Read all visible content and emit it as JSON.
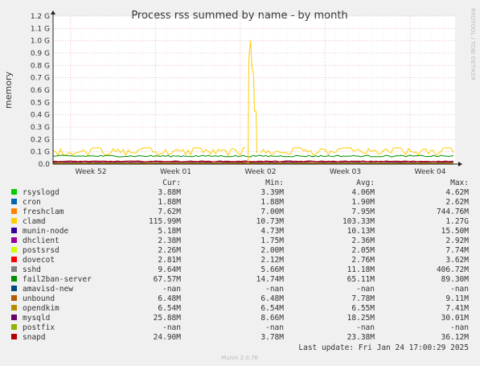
{
  "chart_data": {
    "type": "line",
    "title": "Process rss summed by name - by month",
    "ylabel": "memory",
    "side_label": "RRDTOOL / TOBI OETIKER",
    "yticks": [
      "0.0",
      "0.1 G",
      "0.2 G",
      "0.3 G",
      "0.4 G",
      "0.5 G",
      "0.6 G",
      "0.7 G",
      "0.8 G",
      "0.9 G",
      "1.0 G",
      "1.1 G",
      "1.2 G"
    ],
    "ylim": [
      0,
      1.2
    ],
    "xticks": [
      "Week 52",
      "Week 01",
      "Week 02",
      "Week 03",
      "Week 04"
    ],
    "legend_headers": [
      "Cur:",
      "Min:",
      "Avg:",
      "Max:"
    ],
    "series": [
      {
        "name": "rsyslogd",
        "color": "#00cc00",
        "cur": "3.88M",
        "min": "3.39M",
        "avg": "4.06M",
        "max": "4.62M",
        "level": 0.004
      },
      {
        "name": "cron",
        "color": "#0066b3",
        "cur": "1.88M",
        "min": "1.88M",
        "avg": "1.90M",
        "max": "2.62M",
        "level": 0.002
      },
      {
        "name": "freshclam",
        "color": "#ff8000",
        "cur": "7.62M",
        "min": "7.00M",
        "avg": "7.95M",
        "max": "744.76M",
        "level": 0.008
      },
      {
        "name": "clamd",
        "color": "#ffcc00",
        "cur": "115.99M",
        "min": "10.73M",
        "avg": "103.33M",
        "max": "1.27G",
        "level": 0.105
      },
      {
        "name": "munin-node",
        "color": "#330099",
        "cur": "5.18M",
        "min": "4.73M",
        "avg": "10.13M",
        "max": "15.50M",
        "level": 0.01
      },
      {
        "name": "dhclient",
        "color": "#990099",
        "cur": "2.38M",
        "min": "1.75M",
        "avg": "2.36M",
        "max": "2.92M",
        "level": 0.002
      },
      {
        "name": "postsrsd",
        "color": "#ccff00",
        "cur": "2.26M",
        "min": "2.00M",
        "avg": "2.05M",
        "max": "7.74M",
        "level": 0.002
      },
      {
        "name": "dovecot",
        "color": "#ff0000",
        "cur": "2.81M",
        "min": "2.12M",
        "avg": "2.76M",
        "max": "3.62M",
        "level": 0.003
      },
      {
        "name": "sshd",
        "color": "#808080",
        "cur": "9.64M",
        "min": "5.66M",
        "avg": "11.18M",
        "max": "406.72M",
        "level": 0.011
      },
      {
        "name": "fail2ban-server",
        "color": "#008f00",
        "cur": "67.57M",
        "min": "14.74M",
        "avg": "65.11M",
        "max": "89.30M",
        "level": 0.065
      },
      {
        "name": "amavisd-new",
        "color": "#00487d",
        "cur": "-nan",
        "min": "-nan",
        "avg": "-nan",
        "max": "-nan",
        "level": null
      },
      {
        "name": "unbound",
        "color": "#b35a00",
        "cur": "6.48M",
        "min": "6.48M",
        "avg": "7.78M",
        "max": "9.11M",
        "level": 0.008
      },
      {
        "name": "opendkim",
        "color": "#b38f00",
        "cur": "6.54M",
        "min": "6.54M",
        "avg": "6.55M",
        "max": "7.41M",
        "level": 0.007
      },
      {
        "name": "mysqld",
        "color": "#6b006b",
        "cur": "25.88M",
        "min": "8.66M",
        "avg": "18.25M",
        "max": "30.01M",
        "level": 0.018
      },
      {
        "name": "postfix",
        "color": "#8fb300",
        "cur": "-nan",
        "min": "-nan",
        "avg": "-nan",
        "max": "-nan",
        "level": null
      },
      {
        "name": "snapd",
        "color": "#b30000",
        "cur": "24.90M",
        "min": "3.78M",
        "avg": "23.38M",
        "max": "36.12M",
        "level": 0.023
      }
    ],
    "last_update": "Last update: Fri Jan 24 17:00:29 2025",
    "footer": "Munin 2.0.76"
  }
}
